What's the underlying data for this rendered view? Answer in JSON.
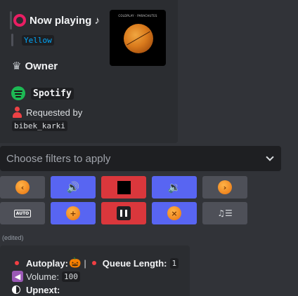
{
  "now_playing": {
    "title": "Now playing ♪",
    "song": "Yellow",
    "owner_label": "Owner",
    "source": "Spotify",
    "requested_label": "Requested by",
    "requester": "bibek_karki",
    "cover_text": "COLDPLAY · PARACHUTES",
    "accent_color": "#e91e63"
  },
  "filter_select": {
    "placeholder": "Choose filters to apply"
  },
  "controls": {
    "row1": [
      {
        "name": "previous",
        "icon": "orange-back-icon",
        "style": "grey"
      },
      {
        "name": "volume-up",
        "icon": "speaker-loud-icon",
        "style": "blurple"
      },
      {
        "name": "stop",
        "icon": "stop-icon",
        "style": "red"
      },
      {
        "name": "volume-down",
        "icon": "speaker-low-icon",
        "style": "blurple"
      },
      {
        "name": "skip",
        "icon": "orange-forward-icon",
        "style": "grey"
      }
    ],
    "row2": [
      {
        "name": "autoplay",
        "icon": "auto-icon",
        "label": "AUTO",
        "style": "grey"
      },
      {
        "name": "shuffle",
        "icon": "orange-cross-icon",
        "style": "blurple"
      },
      {
        "name": "pause",
        "icon": "pause-icon",
        "style": "red"
      },
      {
        "name": "clear",
        "icon": "orange-x-icon",
        "style": "blurple"
      },
      {
        "name": "queue",
        "icon": "queue-lines-icon",
        "style": "grey"
      }
    ]
  },
  "edited_label": "(edited)",
  "status": {
    "autoplay_label": "Autoplay:",
    "separator": "|",
    "queue_length_label": "Queue Length:",
    "queue_length": "1",
    "volume_label": "Volume:",
    "volume": "100",
    "upnext_label": "Upnext:"
  }
}
